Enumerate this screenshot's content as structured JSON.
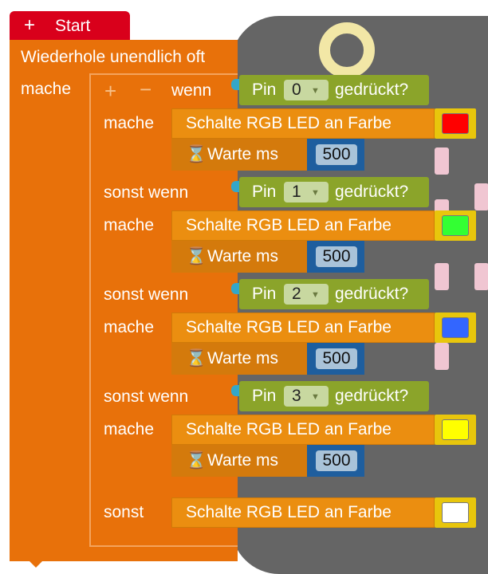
{
  "start_block": {
    "label": "Start"
  },
  "forever_block": {
    "label": "Wiederhole unendlich oft",
    "do_label": "mache"
  },
  "if_block": {
    "if_label": "wenn",
    "elseif_label": "sonst wenn",
    "do_label": "mache",
    "else_label": "sonst",
    "plus_icon": "plus-icon",
    "minus_icon": "minus-icon"
  },
  "branches": [
    {
      "pin_prefix": "Pin",
      "pin_value": "0",
      "pin_suffix": "gedrückt?",
      "led_label": "Schalte RGB LED an Farbe",
      "color": "#ff0000",
      "wait_label": "Warte ms",
      "wait_value": "500"
    },
    {
      "pin_prefix": "Pin",
      "pin_value": "1",
      "pin_suffix": "gedrückt?",
      "led_label": "Schalte RGB LED an Farbe",
      "color": "#33ff33",
      "wait_label": "Warte ms",
      "wait_value": "500"
    },
    {
      "pin_prefix": "Pin",
      "pin_value": "2",
      "pin_suffix": "gedrückt?",
      "led_label": "Schalte RGB LED an Farbe",
      "color": "#3366ff",
      "wait_label": "Warte ms",
      "wait_value": "500"
    },
    {
      "pin_prefix": "Pin",
      "pin_value": "3",
      "pin_suffix": "gedrückt?",
      "led_label": "Schalte RGB LED an Farbe",
      "color": "#ffff00",
      "wait_label": "Warte ms",
      "wait_value": "500"
    }
  ],
  "else_branch": {
    "led_label": "Schalte RGB LED an Farbe",
    "color": "#ffffff"
  },
  "colors": {
    "start": "#d9001b",
    "control": "#e8710a",
    "action": "#eb8e10",
    "condition": "#8ba42a",
    "number": "#1e5e9e"
  }
}
